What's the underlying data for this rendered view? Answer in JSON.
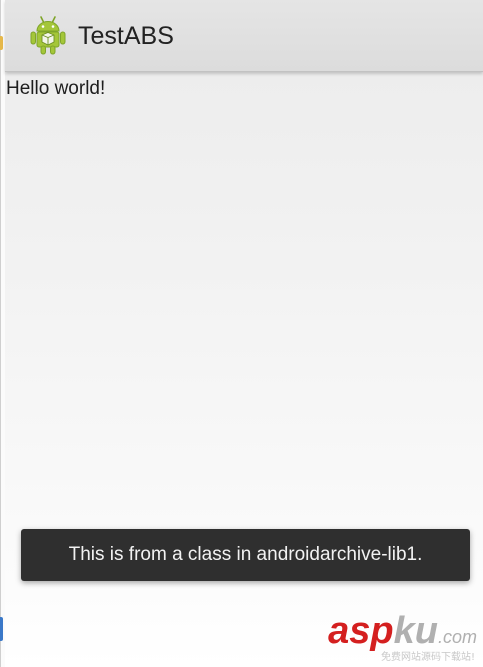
{
  "action_bar": {
    "title": "TestABS",
    "icon": "android-robot-icon"
  },
  "content": {
    "hello_text": "Hello world!"
  },
  "toast": {
    "message": "This is from a class in androidarchive-lib1."
  },
  "watermark": {
    "brand_red": "asp",
    "brand_gray": "ku",
    "brand_suffix": ".com",
    "slogan": "免费网站源码下载站!"
  },
  "colors": {
    "action_bar_bg": "#dcdcdc",
    "toast_bg": "#2f2f2f",
    "android_green": "#a4c639",
    "watermark_red": "#d41f1f"
  }
}
